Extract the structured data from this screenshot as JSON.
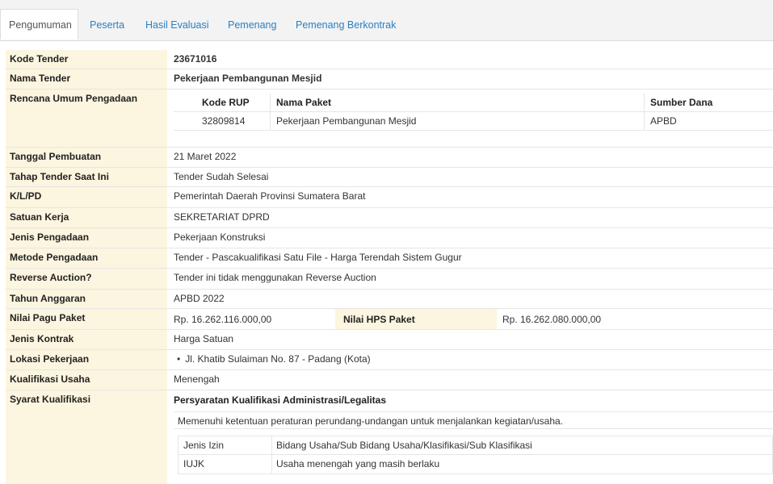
{
  "tabs": [
    {
      "label": "Pengumuman"
    },
    {
      "label": "Peserta"
    },
    {
      "label": "Hasil Evaluasi"
    },
    {
      "label": "Pemenang"
    },
    {
      "label": "Pemenang Berkontrak"
    }
  ],
  "fields": {
    "kode_tender": {
      "label": "Kode Tender",
      "value": "23671016"
    },
    "nama_tender": {
      "label": "Nama Tender",
      "value": "Pekerjaan Pembangunan Mesjid"
    },
    "rup": {
      "label": "Rencana Umum Pengadaan",
      "headers": {
        "kode": "Kode RUP",
        "nama": "Nama Paket",
        "sumber": "Sumber Dana"
      },
      "rows": [
        {
          "kode": "32809814",
          "nama": "Pekerjaan Pembangunan Mesjid",
          "sumber": "APBD"
        }
      ]
    },
    "tanggal": {
      "label": "Tanggal Pembuatan",
      "value": "21 Maret 2022"
    },
    "tahap": {
      "label": "Tahap Tender Saat Ini",
      "value": "Tender Sudah Selesai"
    },
    "klpd": {
      "label": "K/L/PD",
      "value": "Pemerintah Daerah Provinsi Sumatera Barat"
    },
    "satker": {
      "label": "Satuan Kerja",
      "value": "SEKRETARIAT DPRD"
    },
    "jenis_pengadaan": {
      "label": "Jenis Pengadaan",
      "value": "Pekerjaan Konstruksi"
    },
    "metode": {
      "label": "Metode Pengadaan",
      "value": "Tender - Pascakualifikasi Satu File - Harga Terendah Sistem Gugur"
    },
    "reverse": {
      "label": "Reverse Auction?",
      "value": "Tender ini tidak menggunakan Reverse Auction"
    },
    "tahun": {
      "label": "Tahun Anggaran",
      "value": "APBD 2022"
    },
    "pagu": {
      "label": "Nilai Pagu Paket",
      "value": "Rp. 16.262.116.000,00",
      "hps_label": "Nilai HPS Paket",
      "hps_value": "Rp. 16.262.080.000,00"
    },
    "jenis_kontrak": {
      "label": "Jenis Kontrak",
      "value": "Harga Satuan"
    },
    "lokasi": {
      "label": "Lokasi Pekerjaan",
      "value": "Jl. Khatib Sulaiman No. 87 - Padang (Kota)"
    },
    "kualifikasi": {
      "label": "Kualifikasi Usaha",
      "value": "Menengah"
    },
    "syarat": {
      "label": "Syarat Kualifikasi",
      "heading": "Persyaratan Kualifikasi Administrasi/Legalitas",
      "note": "Memenuhi ketentuan peraturan perundang-undangan untuk menjalankan kegiatan/usaha.",
      "rows": [
        {
          "a": "Jenis Izin",
          "b": "Bidang Usaha/Sub Bidang Usaha/Klasifikasi/Sub Klasifikasi"
        },
        {
          "a": "IUJK",
          "b": "Usaha menengah yang masih berlaku"
        }
      ]
    }
  },
  "colors": {
    "label_bg": "#fcf5df",
    "link": "#2a7fc1",
    "border": "#e6e6e6"
  }
}
